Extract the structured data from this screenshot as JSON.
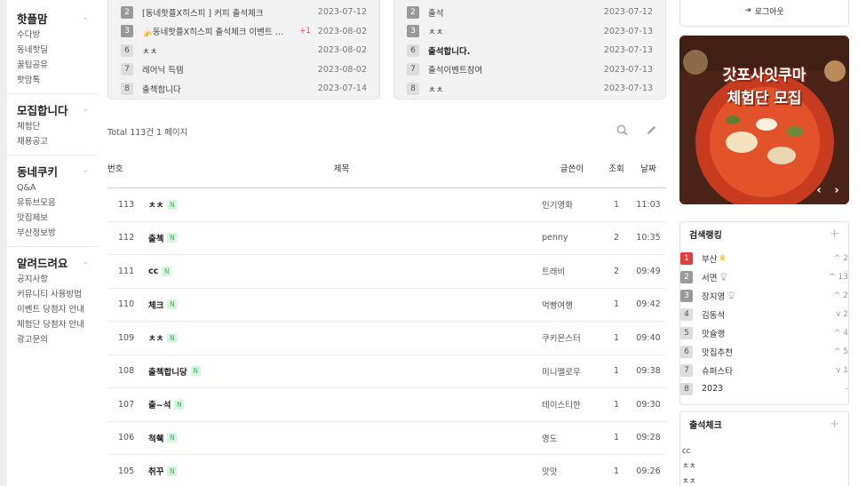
{
  "sidebar": {
    "groups": [
      {
        "title": "핫플맘",
        "items": [
          "수다방",
          "동네핫딜",
          "꿀팁공유",
          "핫맘톡"
        ]
      },
      {
        "title": "모집합니다",
        "items": [
          "체험단",
          "채용공고"
        ]
      },
      {
        "title": "동네쿠키",
        "items": [
          "Q&A",
          "유튜브모음",
          "맛집제보",
          "부산정보방"
        ]
      },
      {
        "title": "알려드려요",
        "items": [
          "공지사항",
          "커뮤니티 사용방법",
          "이벤트 당첨자 안내",
          "체험단 당첨자 안내",
          "광고문의"
        ]
      }
    ]
  },
  "box_left": {
    "rows": [
      {
        "num": "2",
        "title": "[동네핫플X히스피 ] 커피 출석체크",
        "date": "2023-07-12",
        "bold": false
      },
      {
        "num": "3",
        "title": "🍌동네핫플X히스피 출석체크 이벤트 …",
        "extra": "+1",
        "date": "2023-08-02",
        "bold": false
      },
      {
        "num": "6",
        "title": "ㅊㅊ",
        "date": "2023-08-02",
        "bold": false
      },
      {
        "num": "7",
        "title": "레어닉 득템",
        "date": "2023-08-02",
        "bold": false
      },
      {
        "num": "8",
        "title": "출첵합니다",
        "date": "2023-07-14",
        "bold": false
      }
    ]
  },
  "box_right": {
    "rows": [
      {
        "num": "2",
        "title": "출석",
        "date": "2023-07-12",
        "bold": false
      },
      {
        "num": "3",
        "title": "ㅊㅊ",
        "date": "2023-07-13",
        "bold": false
      },
      {
        "num": "6",
        "title": "출석합니다.",
        "date": "2023-07-13",
        "bold": true
      },
      {
        "num": "7",
        "title": "출석이벤트참여",
        "date": "2023-07-13",
        "bold": false
      },
      {
        "num": "8",
        "title": "ㅊㅊ",
        "date": "2023-07-13",
        "bold": false
      }
    ]
  },
  "board": {
    "total": "Total 113건 1 페이지",
    "columns": {
      "no": "번호",
      "title": "제목",
      "author": "글쓴이",
      "hits": "조회",
      "date": "날짜"
    },
    "new_badge": "N",
    "rows": [
      {
        "no": "113",
        "title": "ㅊㅊ",
        "author": "인기영화",
        "hits": "1",
        "date": "11:03"
      },
      {
        "no": "112",
        "title": "출첵",
        "author": "penny",
        "hits": "2",
        "date": "10:35"
      },
      {
        "no": "111",
        "title": "cc",
        "author": "트래비",
        "hits": "2",
        "date": "09:49"
      },
      {
        "no": "110",
        "title": "체크",
        "author": "먹빵여행",
        "hits": "1",
        "date": "09:42"
      },
      {
        "no": "109",
        "title": "ㅊㅊ",
        "author": "쿠키몬스터",
        "hits": "1",
        "date": "09:40"
      },
      {
        "no": "108",
        "title": "출첵합니당",
        "author": "미니멜로우",
        "hits": "1",
        "date": "09:38"
      },
      {
        "no": "107",
        "title": "출~석",
        "author": "테이스티한",
        "hits": "1",
        "date": "09:30"
      },
      {
        "no": "106",
        "title": "척췍",
        "author": "영도",
        "hits": "1",
        "date": "09:28"
      },
      {
        "no": "105",
        "title": "취꾸",
        "author": "맛맛",
        "hits": "1",
        "date": "09:26"
      }
    ]
  },
  "right": {
    "logout": "로그아웃",
    "banner_line1": "갓포사잇쿠마",
    "banner_line2": "체험단 모집",
    "ranking_title": "검색랭킹",
    "ranking": [
      {
        "num": "1",
        "name": "부산",
        "icon": "crown",
        "change": "^ 2"
      },
      {
        "num": "2",
        "name": "서면",
        "icon": "trophy",
        "change": "^ 13"
      },
      {
        "num": "3",
        "name": "장지영",
        "icon": "trophy",
        "change": "^ 2"
      },
      {
        "num": "4",
        "name": "김동석",
        "icon": "",
        "change": "v 2"
      },
      {
        "num": "5",
        "name": "맛슐랭",
        "icon": "",
        "change": "^ 4"
      },
      {
        "num": "6",
        "name": "맛집추천",
        "icon": "",
        "change": "^ 5"
      },
      {
        "num": "7",
        "name": "슈퍼스타",
        "icon": "",
        "change": "v 1"
      },
      {
        "num": "8",
        "name": "2023",
        "icon": "",
        "change": "-"
      }
    ],
    "attendance_title": "출석체크",
    "attendance": [
      "cc",
      "ㅊㅊ",
      "ㅊㅊ"
    ]
  },
  "colors": {
    "rank_top": "#e43d3d",
    "new_badge": "#3fb65a",
    "crown": "#f0b400"
  }
}
